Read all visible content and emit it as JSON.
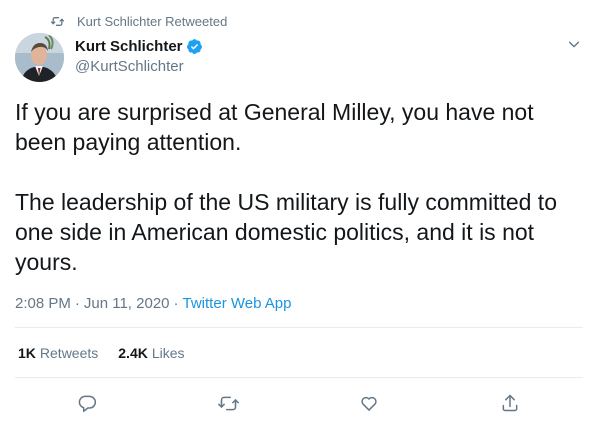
{
  "retweet_banner": {
    "text": "Kurt Schlichter Retweeted",
    "icon": "retweet-icon"
  },
  "author": {
    "display_name": "Kurt Schlichter",
    "handle": "@KurtSchlichter",
    "verified": true,
    "verified_icon": "verified-badge-icon",
    "avatar": "avatar"
  },
  "tweet": {
    "paragraphs": [
      "If you are surprised at General Milley, you have not been paying attention.",
      "The leadership of the US military is fully committed to one side in American domestic politics, and it is not yours."
    ]
  },
  "meta": {
    "time": "2:08 PM",
    "separator": "·",
    "date": "Jun 11, 2020",
    "source": "Twitter Web App"
  },
  "stats": {
    "retweets_count": "1K",
    "retweets_label": "Retweets",
    "likes_count": "2.4K",
    "likes_label": "Likes"
  },
  "actions": [
    "reply-icon",
    "retweet-icon",
    "like-icon",
    "share-icon"
  ],
  "colors": {
    "primary_text": "#14171a",
    "secondary_text": "#657786",
    "link": "#1b95e0",
    "verified": "#1da1f2",
    "divider": "#e6ecf0"
  }
}
